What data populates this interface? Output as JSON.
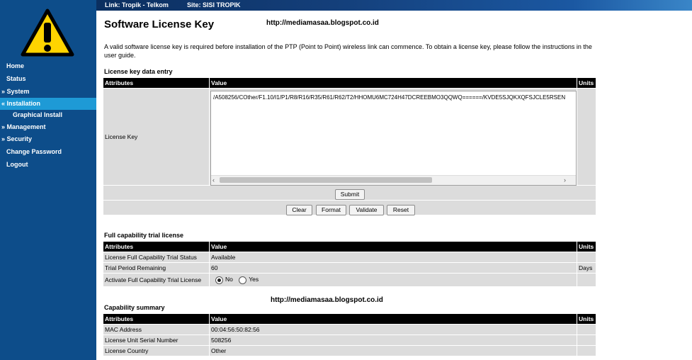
{
  "topbar": {
    "link": "Link: Tropik - Telkom",
    "site": "Site: SISI TROPIK"
  },
  "sidebar": {
    "logo_icon": "warning-triangle-icon",
    "items": [
      {
        "label": "Home"
      },
      {
        "label": "Status"
      },
      {
        "label": "» System"
      },
      {
        "label": "« Installation"
      },
      {
        "label": "Graphical Install"
      },
      {
        "label": "» Management"
      },
      {
        "label": "» Security"
      },
      {
        "label": "Change Password"
      },
      {
        "label": "Logout"
      }
    ]
  },
  "colors": {
    "sidebar": "#0d4d8a",
    "active": "#1e9ad6",
    "header_row": "#000000",
    "cell": "#dcdcdc"
  },
  "page": {
    "title": "Software License Key",
    "watermark": "http://mediamasaa.blogspot.co.id",
    "intro": "A valid software license key is required before installation of the PTP (Point to Point) wireless link can commence. To obtain a license key, please follow the instructions in the user guide."
  },
  "entry": {
    "section": "License key data entry",
    "headers": [
      "Attributes",
      "Value",
      "Units"
    ],
    "key_label": "License Key",
    "key_value": "/A508256/COther/F1.10/I1/P1/R8/R16/R35/R61/R62/T2/HHOMU6MC724H47DCREEBMO3QQWQ======/KVDE5SJQKXQFSJCLE5RSEN",
    "submit": "Submit",
    "clear": "Clear",
    "format": "Format",
    "validate": "Validate",
    "reset": "Reset"
  },
  "trial": {
    "section": "Full capability trial license",
    "headers": [
      "Attributes",
      "Value",
      "Units"
    ],
    "status_label": "License Full Capability Trial Status",
    "status_value": "Available",
    "remaining_label": "Trial Period Remaining",
    "remaining_value": "60",
    "remaining_unit": "Days",
    "activate_label": "Activate Full Capability Trial License",
    "no": "No",
    "yes": "Yes"
  },
  "capability": {
    "section": "Capability summary",
    "headers": [
      "Attributes",
      "Value",
      "Units"
    ],
    "rows": [
      {
        "label": "MAC Address",
        "value": "00:04:56:50:82:56"
      },
      {
        "label": "License Unit Serial Number",
        "value": "508256"
      },
      {
        "label": "License Country",
        "value": "Other"
      }
    ]
  }
}
